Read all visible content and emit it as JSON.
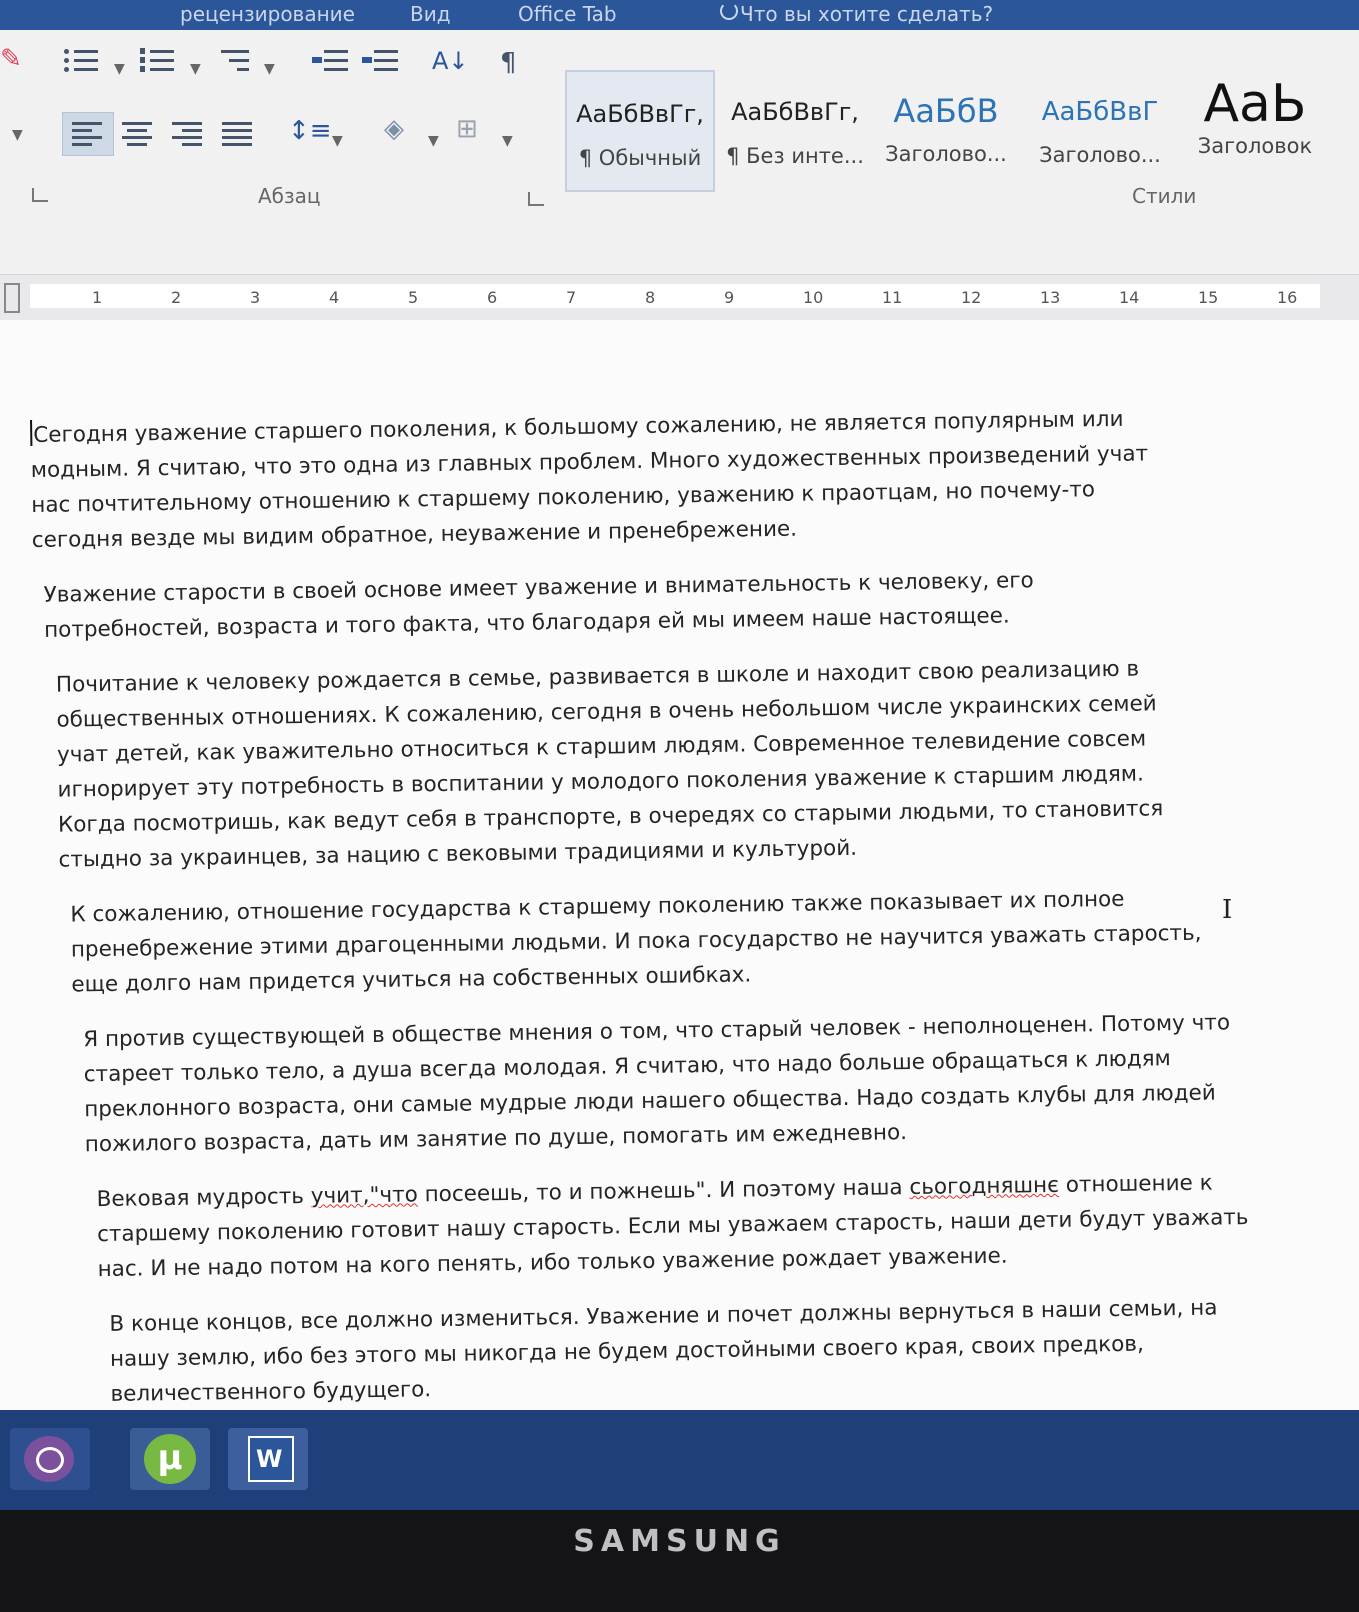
{
  "tabs_bar": {
    "items": [
      "рецензирование",
      "Вид",
      "Office Tab"
    ],
    "tell_me": "Что вы хотите сделать?"
  },
  "ribbon": {
    "paragraph_group_label": "Абзац",
    "styles_group_label": "Стили",
    "styles": [
      {
        "sample": "АаБбВвГг,",
        "name": "¶ Обычный"
      },
      {
        "sample": "АаБбВвГг,",
        "name": "¶ Без инте..."
      },
      {
        "sample": "АаБбВ",
        "name": "Заголово..."
      },
      {
        "sample": "АаБбВвГ",
        "name": "Заголово..."
      },
      {
        "sample": "АаЬ",
        "name": "Заголовок"
      }
    ],
    "accent_color": "#2b579a"
  },
  "ruler": {
    "numbers": [
      "1",
      "2",
      "3",
      "4",
      "5",
      "6",
      "7",
      "8",
      "9",
      "10",
      "11",
      "12",
      "13",
      "14",
      "15",
      "16"
    ]
  },
  "document": {
    "paragraphs": [
      {
        "lines": [
          "Сегодня уважение старшего поколения, к большому сожалению, не является популярным или",
          "модным. Я считаю, что это одна из главных проблем. Много художественных произведений учат",
          "нас почтительному отношению к старшему поколению, уважению к праотцам, но почему-то",
          "сегодня везде мы видим обратное, неуважение и пренебрежение."
        ]
      },
      {
        "lines": [
          "Уважение старости в своей основе имеет уважение и внимательность к человеку, его",
          "потребностей, возраста и того факта, что благодаря ей мы имеем наше настоящее."
        ]
      },
      {
        "lines": [
          "Почитание к человеку рождается в семье, развивается в школе и находит свою реализацию в",
          "общественных отношениях. К сожалению, сегодня в очень небольшом числе украинских семей",
          "учат детей, как уважительно относиться к старшим людям. Современное телевидение совсем",
          "игнорирует эту потребность в воспитании у молодого поколения уважение к старшим людям.",
          "Когда посмотришь, как ведут себя в транспорте, в очередях со старыми людьми, то становится",
          "стыдно за украинцев, за нацию с вековыми традициями и культурой."
        ]
      },
      {
        "lines": [
          "К сожалению, отношение государства к старшему поколению также показывает их полное",
          "пренебрежение этими драгоценными людьми. И пока государство не научится уважать старость,",
          "еще долго нам придется учиться на собственных ошибках."
        ]
      },
      {
        "lines": [
          "Я против существующей в обществе мнения о том, что старый человек - неполноценен. Потому что",
          "стареет только тело, а душа всегда молодая. Я считаю, что надо больше обращаться к людям",
          "преклонного возраста, они самые мудрые люди нашего общества. Надо создать клубы для людей",
          "пожилого возраста, дать им занятие по душе, помогать им ежедневно."
        ]
      },
      {
        "segments": [
          {
            "text": "Вековая мудрость ",
            "spell": false
          },
          {
            "text": "учит,\"что",
            "spell": true
          },
          {
            "text": " посеешь, то и пожнешь\". И поэтому наша ",
            "spell": false
          },
          {
            "text": "сьогодняшнє",
            "spell": true
          },
          {
            "text": " отношение к",
            "spell": false
          }
        ],
        "lines": [
          "старшему поколению готовит нашу старость. Если мы уважаем старость, наши дети будут уважать",
          "нас. И не надо потом на кого пенять, ибо только уважение рождает уважение."
        ]
      },
      {
        "lines": [
          "В конце концов, все должно измениться. Уважение и почет должны вернуться в наши семьи, на",
          "нашу землю, ибо без этого мы никогда не будем достойными своего края, своих предков,",
          "величественного будущего."
        ]
      }
    ]
  },
  "taskbar": {
    "apps": [
      {
        "icon": "viber-icon"
      },
      {
        "icon": "utorrent-icon",
        "glyph": "µ"
      },
      {
        "icon": "word-icon",
        "glyph": "W"
      }
    ]
  },
  "monitor": {
    "brand": "SAMSUNG"
  }
}
